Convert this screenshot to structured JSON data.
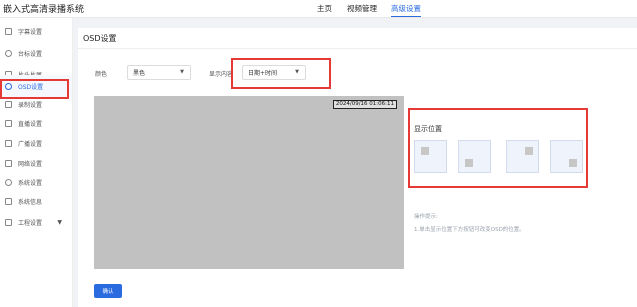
{
  "app": {
    "title": "嵌入式高清录播系统"
  },
  "nav": [
    {
      "label": "主页",
      "active": false
    },
    {
      "label": "视频管理",
      "active": false
    },
    {
      "label": "高级设置",
      "active": true
    }
  ],
  "sidebar": {
    "items": [
      {
        "label": "字幕设置",
        "icon": "subtitle-icon",
        "active": false
      },
      {
        "label": "台标设置",
        "icon": "logo-icon",
        "active": false
      },
      {
        "label": "片头片尾",
        "icon": "film-icon",
        "active": false
      },
      {
        "label": "OSD设置",
        "icon": "clock-icon",
        "active": true
      },
      {
        "label": "录制设置",
        "icon": "record-icon",
        "active": false
      },
      {
        "label": "直播设置",
        "icon": "live-icon",
        "active": false
      },
      {
        "label": "广播设置",
        "icon": "broadcast-icon",
        "active": false
      },
      {
        "label": "网络设置",
        "icon": "network-icon",
        "active": false
      },
      {
        "label": "系统设置",
        "icon": "gear-icon",
        "active": false
      },
      {
        "label": "系统信息",
        "icon": "info-icon",
        "active": false
      },
      {
        "label": "工程设置",
        "icon": "project-icon",
        "active": false,
        "expandable": true
      }
    ]
  },
  "panel": {
    "title": "OSD设置",
    "color_label": "颜色",
    "color_value": "黑色",
    "content_label": "显示内容",
    "content_value": "日期+时间",
    "preview_timestamp": "2024/09/16 01:06:11",
    "position_title": "显示位置",
    "hint_title": "操作提示:",
    "hint_text": "1.单击显示位置下方按钮可改变OSD的位置。",
    "confirm_label": "确认"
  },
  "colors": {
    "accent": "#2b6be0",
    "highlight": "#e53935",
    "preview_bg": "#c1c1c1"
  }
}
